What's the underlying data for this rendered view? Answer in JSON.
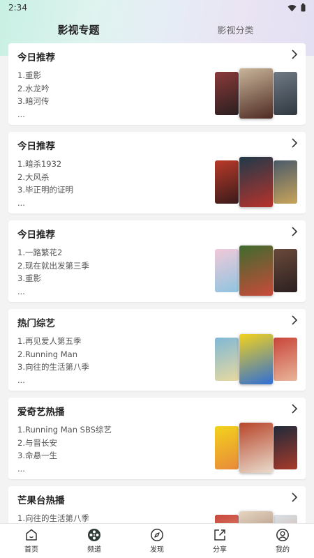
{
  "status": {
    "time": "2:34"
  },
  "tabs": [
    {
      "label": "影视专题",
      "active": true
    },
    {
      "label": "影视分类",
      "active": false
    }
  ],
  "cards": [
    {
      "title": "今日推荐",
      "items": [
        "1.重影",
        "2.水龙吟",
        "3.暗河传",
        "..."
      ],
      "posters": [
        [
          "#8a3a3a",
          "#2b1f1f"
        ],
        [
          "#c9b59a",
          "#4d2a22"
        ],
        [
          "#6f7a85",
          "#303840"
        ]
      ]
    },
    {
      "title": "今日推荐",
      "items": [
        "1.暗杀1932",
        "2.大风杀",
        "3.毕正明的证明",
        "..."
      ],
      "posters": [
        [
          "#b83a2a",
          "#3a1b1b"
        ],
        [
          "#1f3a4a",
          "#b8322a"
        ],
        [
          "#4a5a6a",
          "#c9a45a"
        ]
      ]
    },
    {
      "title": "今日推荐",
      "items": [
        "1.一路繁花2",
        "2.现在就出发第三季",
        "3.重影",
        "..."
      ],
      "posters": [
        [
          "#f1c9d9",
          "#8fc4e0"
        ],
        [
          "#3f6b2e",
          "#c94a3a"
        ],
        [
          "#6a4a3a",
          "#2b2020"
        ]
      ]
    },
    {
      "title": "热门综艺",
      "items": [
        "1.再见爱人第五季",
        "2.Running Man",
        "3.向往的生活第八季",
        "..."
      ],
      "posters": [
        [
          "#7fb8d6",
          "#e8d9a0"
        ],
        [
          "#f3d21c",
          "#2e6fd6"
        ],
        [
          "#c9453a",
          "#e9b59a"
        ]
      ]
    },
    {
      "title": "爱奇艺热播",
      "items": [
        "1.Running Man SBS综艺",
        "2.与晋长安",
        "3.命悬一生",
        "..."
      ],
      "posters": [
        [
          "#f3d21c",
          "#e88a3a"
        ],
        [
          "#b8452a",
          "#e9dccd"
        ],
        [
          "#1f2a3a",
          "#a83a2a"
        ]
      ]
    },
    {
      "title": "芒果台热播",
      "items": [
        "1.向往的生活第八季",
        "",
        "",
        ""
      ],
      "posters": [
        [
          "#c9453a",
          "#e9b59a"
        ],
        [
          "#e6d5c0",
          "#8a6a5a"
        ],
        [
          "#d9e2ea",
          "#c99a7a"
        ]
      ]
    }
  ],
  "bottom_nav": [
    {
      "label": "首页",
      "icon": "home-icon"
    },
    {
      "label": "频道",
      "icon": "film-reel-icon"
    },
    {
      "label": "发现",
      "icon": "compass-icon"
    },
    {
      "label": "分享",
      "icon": "share-icon"
    },
    {
      "label": "我的",
      "icon": "user-icon"
    }
  ]
}
